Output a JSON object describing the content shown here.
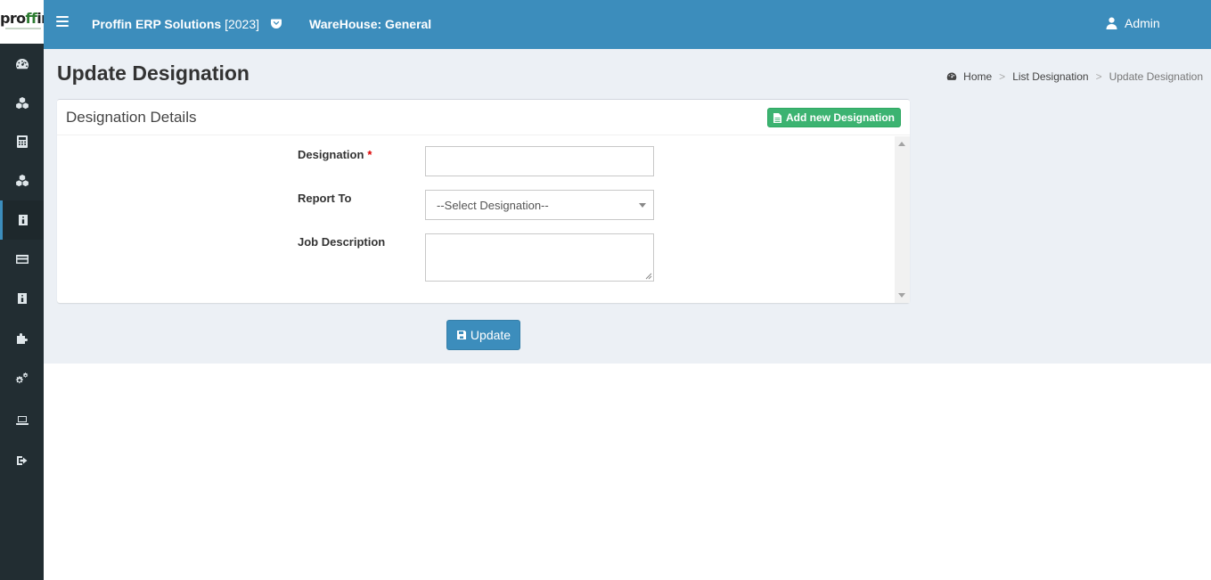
{
  "logo": {
    "text_a": "pro",
    "text_b": "ff",
    "text_c": "in"
  },
  "sidebar": {
    "items": [
      {
        "icon": "dashboard-icon"
      },
      {
        "icon": "cubes-icon"
      },
      {
        "icon": "calculator-icon"
      },
      {
        "icon": "cubes-icon"
      },
      {
        "icon": "id-badge-icon",
        "active": true
      },
      {
        "icon": "credit-card-icon"
      },
      {
        "icon": "id-card-icon"
      },
      {
        "icon": "puzzle-icon"
      },
      {
        "icon": "gears-icon"
      },
      {
        "icon": "laptop-icon"
      },
      {
        "icon": "sign-out-icon"
      }
    ]
  },
  "header": {
    "app_title": "Proffin ERP Solutions",
    "year": "[2023]",
    "warehouse": "WareHouse: General",
    "user": "Admin",
    "color": "#3c8dbc"
  },
  "page": {
    "title": "Update Designation",
    "breadcrumb": {
      "home": "Home",
      "list": "List Designation",
      "current": "Update Designation",
      "separator": ">"
    }
  },
  "box": {
    "title": "Designation Details",
    "add_button": "Add new Designation",
    "add_button_color": "#3cb371"
  },
  "form": {
    "designation_label": "Designation",
    "required_mark": "*",
    "designation_value": "",
    "report_to_label": "Report To",
    "report_to_value": "--Select Designation--",
    "job_description_label": "Job Description",
    "job_description_value": ""
  },
  "actions": {
    "update_label": "Update"
  }
}
